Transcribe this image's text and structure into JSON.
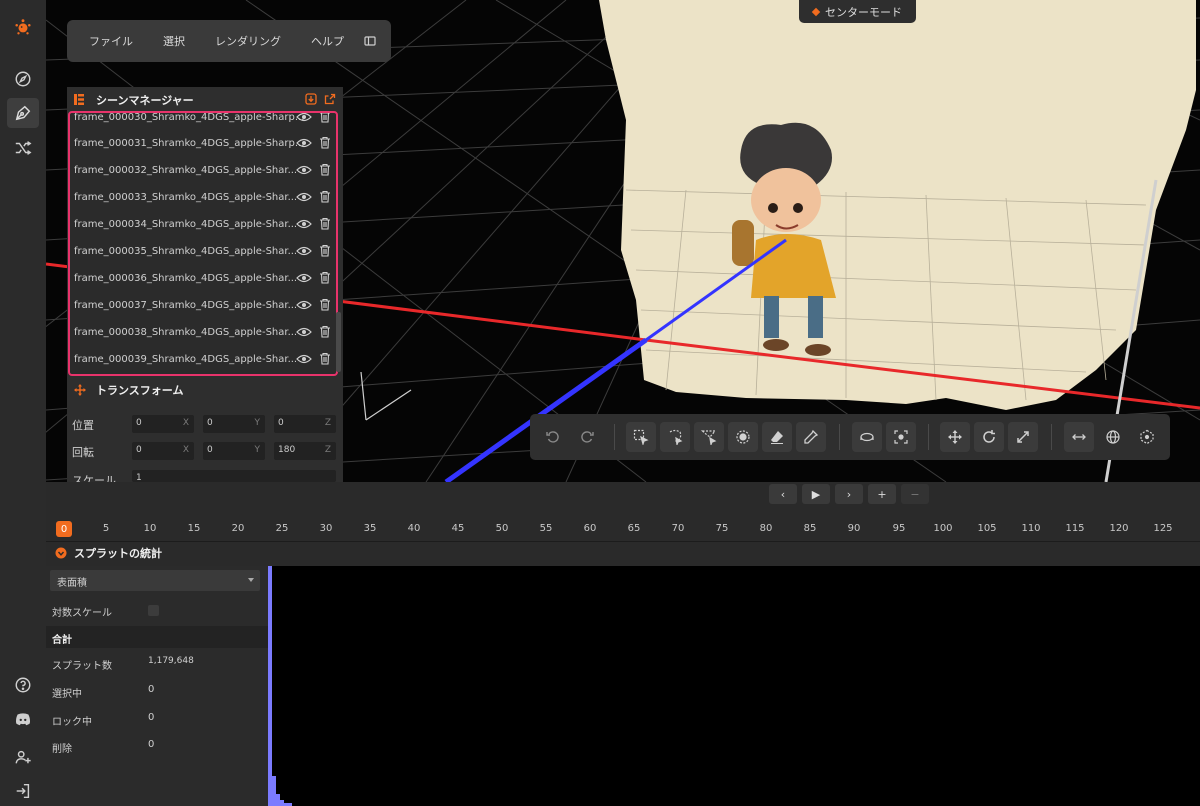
{
  "menubar": {
    "items": [
      "ファイル",
      "選択",
      "レンダリング",
      "ヘルプ"
    ]
  },
  "mode_button": {
    "label": "センターモード"
  },
  "scene_manager": {
    "title": "シーンマネージャー",
    "items": [
      "frame_000030_Shramko_4DGS_apple-Sharp...",
      "frame_000031_Shramko_4DGS_apple-Sharp...",
      "frame_000032_Shramko_4DGS_apple-Shar...",
      "frame_000033_Shramko_4DGS_apple-Shar...",
      "frame_000034_Shramko_4DGS_apple-Shar...",
      "frame_000035_Shramko_4DGS_apple-Shar...",
      "frame_000036_Shramko_4DGS_apple-Shar...",
      "frame_000037_Shramko_4DGS_apple-Shar...",
      "frame_000038_Shramko_4DGS_apple-Shar...",
      "frame_000039_Shramko_4DGS_apple-Shar..."
    ]
  },
  "transform": {
    "title": "トランスフォーム",
    "position": {
      "label": "位置",
      "x": "0",
      "y": "0",
      "z": "0"
    },
    "rotation": {
      "label": "回転",
      "x": "0",
      "y": "0",
      "z": "180"
    },
    "scale": {
      "label": "スケール",
      "value": "1"
    },
    "axes": [
      "X",
      "Y",
      "Z"
    ]
  },
  "timeline": {
    "current": "0",
    "ticks": [
      "5",
      "10",
      "15",
      "20",
      "25",
      "30",
      "35",
      "40",
      "45",
      "50",
      "55",
      "60",
      "65",
      "70",
      "75",
      "80",
      "85",
      "90",
      "95",
      "100",
      "105",
      "110",
      "115",
      "120",
      "125"
    ],
    "controls": [
      "‹",
      "▶",
      "›",
      "+",
      "−"
    ]
  },
  "stats": {
    "title": "スプラットの統計",
    "metric": "表面積",
    "log_scale_label": "対数スケール",
    "section": "合計",
    "rows": [
      {
        "label": "スプラット数",
        "value": "1,179,648"
      },
      {
        "label": "選択中",
        "value": "0"
      },
      {
        "label": "ロック中",
        "value": "0"
      },
      {
        "label": "削除",
        "value": "0"
      }
    ]
  },
  "colors": {
    "accent": "#f26c1f",
    "highlight": "#e8336b",
    "x_axis": "#e8282a",
    "z_axis": "#3434ff",
    "histogram": "#7b7bff"
  }
}
